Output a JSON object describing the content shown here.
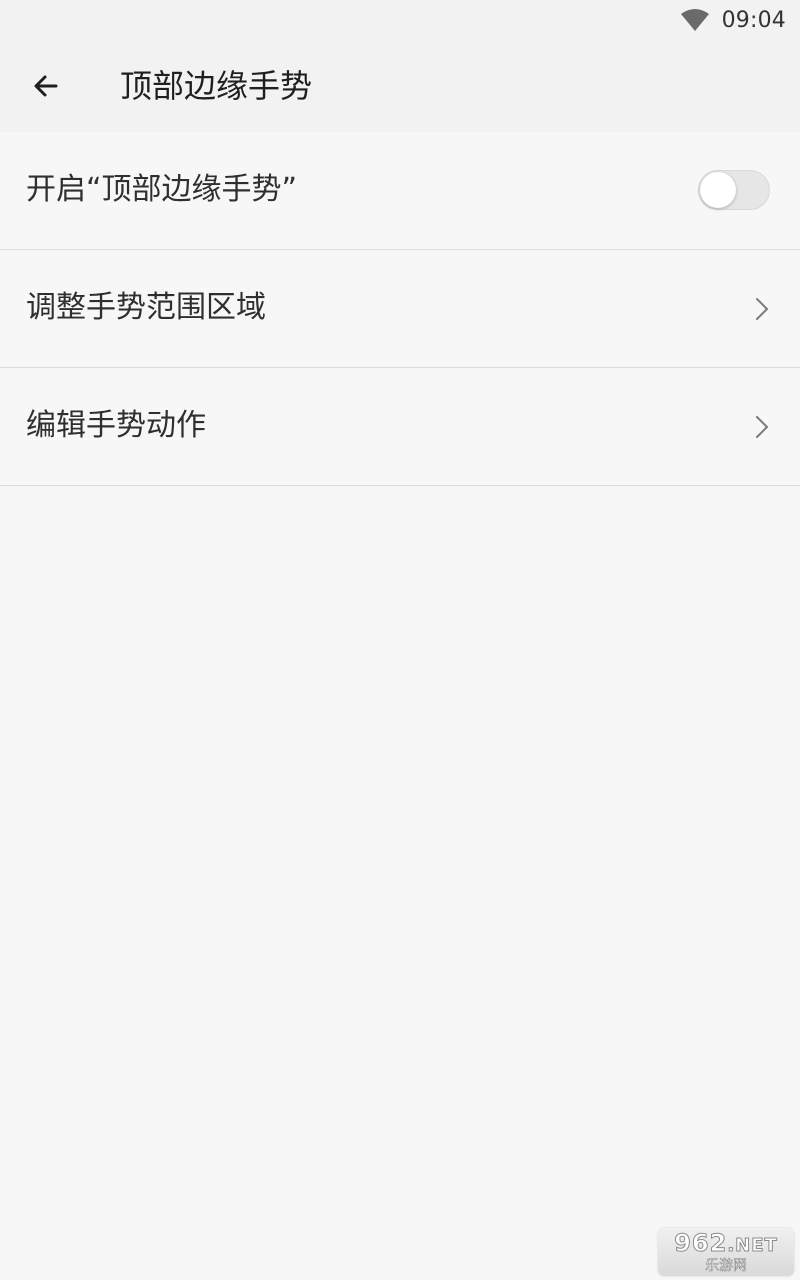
{
  "status_bar": {
    "time": "09:04",
    "wifi_icon": "wifi-icon"
  },
  "app_bar": {
    "back_icon": "arrow-left-icon",
    "title": "顶部边缘手势"
  },
  "settings": {
    "toggle_row": {
      "label": "开启“顶部边缘手势”",
      "enabled": false
    },
    "rows": [
      {
        "label": "调整手势范围区域",
        "icon": "chevron-right-icon"
      },
      {
        "label": "编辑手势动作",
        "icon": "chevron-right-icon"
      }
    ]
  },
  "watermark": {
    "main": "962",
    "suffix": ".NET",
    "sub": "乐游网"
  },
  "colors": {
    "background": "#f7f7f7",
    "app_bar": "#f2f2f2",
    "divider": "#dcdcdc",
    "toggle_off_track": "#e6e6e6"
  }
}
